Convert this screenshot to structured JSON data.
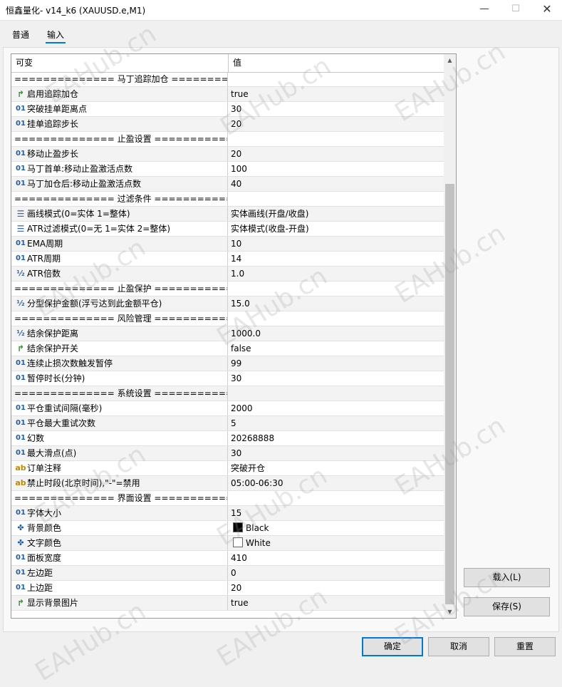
{
  "window": {
    "title": "恒鑫量化- v14_k6 (XAUUSD.e,M1)",
    "minimize": "—",
    "maximize": "☐",
    "close": "✕"
  },
  "tabs": [
    {
      "label": "普通"
    },
    {
      "label": "输入"
    }
  ],
  "grid": {
    "col_variable": "可变",
    "col_value": "值",
    "rows": [
      {
        "type": "sep",
        "name": "============== 马丁追踪加仓 =============="
      },
      {
        "type": "bool",
        "icon": "↱",
        "name": "启用追踪加仓",
        "value": "true"
      },
      {
        "type": "int",
        "icon": "01",
        "name": "突破挂单距离点",
        "value": "30"
      },
      {
        "type": "int",
        "icon": "01",
        "name": "挂单追踪步长",
        "value": "20"
      },
      {
        "type": "sep",
        "name": "============== 止盈设置 ==============="
      },
      {
        "type": "int",
        "icon": "01",
        "name": "移动止盈步长",
        "value": "20"
      },
      {
        "type": "int",
        "icon": "01",
        "name": "马丁首单:移动止盈激活点数",
        "value": "100"
      },
      {
        "type": "int",
        "icon": "01",
        "name": "马丁加仓后:移动止盈激活点数",
        "value": "40"
      },
      {
        "type": "sep",
        "name": "============== 过滤条件 ==============="
      },
      {
        "type": "enum",
        "icon": "☰",
        "name": "画线模式(0=实体 1=整体)",
        "value": "实体画线(开盘/收盘)"
      },
      {
        "type": "enum",
        "icon": "☰",
        "name": "ATR过滤模式(0=无 1=实体 2=整体)",
        "value": "实体模式(收盘-开盘)"
      },
      {
        "type": "int",
        "icon": "01",
        "name": "EMA周期",
        "value": "10"
      },
      {
        "type": "int",
        "icon": "01",
        "name": "ATR周期",
        "value": "14"
      },
      {
        "type": "half",
        "icon": "½",
        "name": "ATR倍数",
        "value": "1.0"
      },
      {
        "type": "sep",
        "name": "============== 止盈保护 ==============="
      },
      {
        "type": "half",
        "icon": "½",
        "name": "分型保护金额(浮亏达到此金额平仓)",
        "value": "15.0"
      },
      {
        "type": "sep",
        "name": "============== 风险管理 ==============="
      },
      {
        "type": "half",
        "icon": "½",
        "name": "结余保护距离",
        "value": "1000.0"
      },
      {
        "type": "bool",
        "icon": "↱",
        "name": "结余保护开关",
        "value": "false"
      },
      {
        "type": "int",
        "icon": "01",
        "name": "连续止损次数触发暂停",
        "value": "99"
      },
      {
        "type": "int",
        "icon": "01",
        "name": "暂停时长(分钟)",
        "value": "30"
      },
      {
        "type": "sep",
        "name": "============== 系统设置 ==============="
      },
      {
        "type": "int",
        "icon": "01",
        "name": "平仓重试间隔(毫秒)",
        "value": "2000"
      },
      {
        "type": "int",
        "icon": "01",
        "name": "平仓最大重试次数",
        "value": "5"
      },
      {
        "type": "int",
        "icon": "01",
        "name": "幻数",
        "value": "20268888"
      },
      {
        "type": "int",
        "icon": "01",
        "name": "最大滑点(点)",
        "value": "30"
      },
      {
        "type": "str",
        "icon": "ab",
        "name": "订单注释",
        "value": "突破开仓"
      },
      {
        "type": "str",
        "icon": "ab",
        "name": "禁止时段(北京时间),\"-\"=禁用",
        "value": "05:00-06:30"
      },
      {
        "type": "sep",
        "name": "============== 界面设置 ==============="
      },
      {
        "type": "int",
        "icon": "01",
        "name": "字体大小",
        "value": "15"
      },
      {
        "type": "color",
        "icon": "✤",
        "name": "背景颜色",
        "value": "Black",
        "swatch": "#000000"
      },
      {
        "type": "color",
        "icon": "✤",
        "name": "文字颜色",
        "value": "White",
        "swatch": "#ffffff"
      },
      {
        "type": "int",
        "icon": "01",
        "name": "面板宽度",
        "value": "410"
      },
      {
        "type": "int",
        "icon": "01",
        "name": "左边距",
        "value": "0"
      },
      {
        "type": "int",
        "icon": "01",
        "name": "上边距",
        "value": "20"
      },
      {
        "type": "bool",
        "icon": "↱",
        "name": "显示背景图片",
        "value": "true"
      }
    ]
  },
  "side_buttons": {
    "load": "载入(L)",
    "save": "保存(S)"
  },
  "footer_buttons": {
    "ok": "确定",
    "cancel": "取消",
    "reset": "重置"
  },
  "watermark": "EAHub.cn"
}
